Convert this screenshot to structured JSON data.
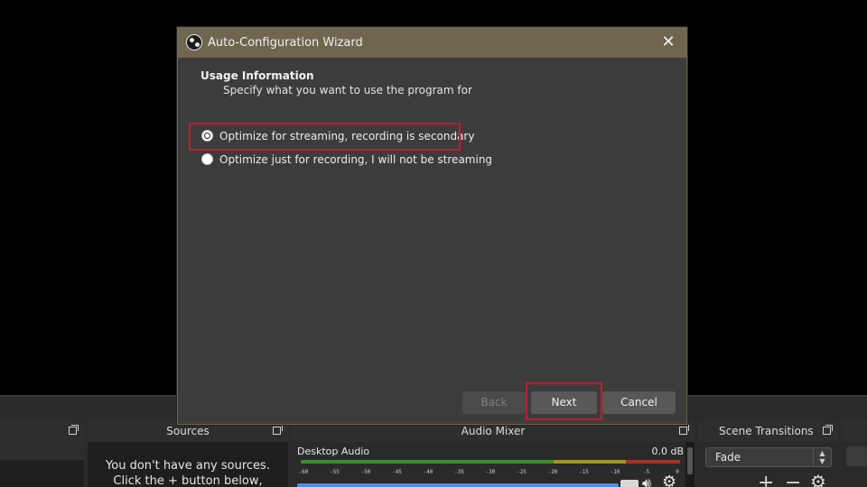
{
  "dialog": {
    "title": "Auto-Configuration Wizard",
    "close_glyph": "✕",
    "section_title": "Usage Information",
    "section_subtitle": "Specify what you want to use the program for",
    "options": [
      {
        "label": "Optimize for streaming, recording is secondary",
        "selected": true
      },
      {
        "label": "Optimize just for recording, I will not be streaming",
        "selected": false
      }
    ],
    "buttons": {
      "back": "Back",
      "next": "Next",
      "cancel": "Cancel"
    },
    "highlight_color": "#d0142b"
  },
  "docks": {
    "sources": {
      "title": "Sources",
      "empty_line1": "You don't have any sources.",
      "empty_line2": "Click the + button below,"
    },
    "audio_mixer": {
      "title": "Audio Mixer",
      "channel": "Desktop Audio",
      "level": "0.0 dB",
      "ticks": [
        "-60",
        "-55",
        "-50",
        "-45",
        "-40",
        "-35",
        "-30",
        "-25",
        "-20",
        "-15",
        "-10",
        "-5",
        "0"
      ]
    },
    "scene_transitions": {
      "title": "Scene Transitions",
      "selected": "Fade"
    }
  },
  "icons": {
    "obs_logo": "obs-logo-icon",
    "close": "close-icon",
    "add": "plus-icon",
    "remove": "minus-icon",
    "settings": "gear-icon",
    "volume": "speaker-icon"
  }
}
